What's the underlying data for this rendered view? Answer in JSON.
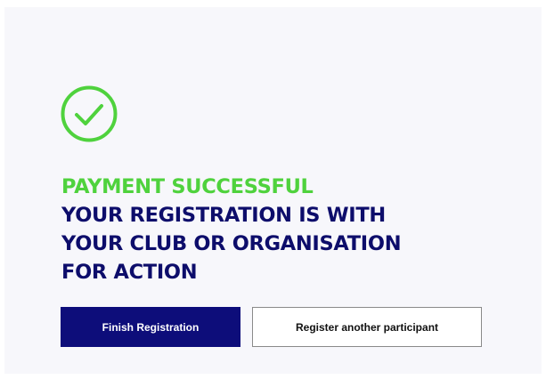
{
  "status": {
    "icon": "check-circle-icon",
    "success_color": "#4fd23d"
  },
  "heading": {
    "success": "PAYMENT SUCCESSFUL",
    "line1": "YOUR REGISTRATION IS WITH",
    "line2": "YOUR CLUB OR ORGANISATION",
    "line3": "FOR ACTION",
    "text_color": "#0d0d6b"
  },
  "actions": {
    "finish_label": "Finish Registration",
    "register_another_label": "Register another participant",
    "primary_color": "#0d0d7a"
  }
}
